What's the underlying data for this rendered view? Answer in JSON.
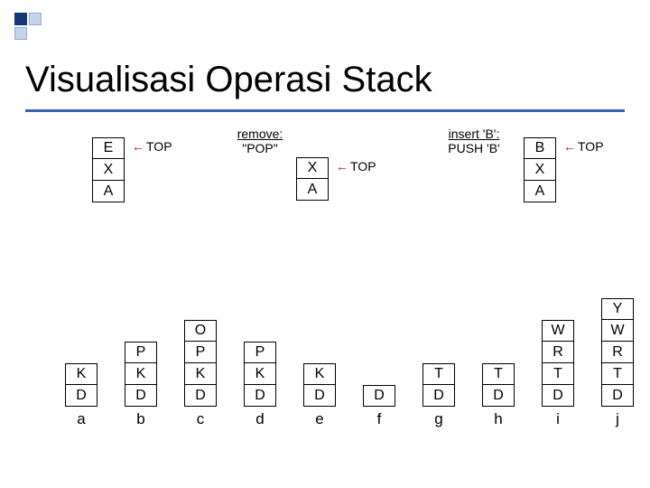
{
  "title": "Visualisasi Operasi Stack",
  "top_pointers": {
    "left": {
      "cells": [
        "E",
        "X",
        "A"
      ],
      "top_label": "TOP"
    },
    "mid": {
      "cells": [
        "X",
        "A"
      ],
      "top_label": "TOP",
      "op_u": "remove:",
      "op_l": "\"POP\""
    },
    "right": {
      "cells": [
        "B",
        "X",
        "A"
      ],
      "top_label": "TOP",
      "op_u": "insert 'B':",
      "op_l": "PUSH 'B'"
    }
  },
  "history": {
    "a": [
      "K",
      "D"
    ],
    "b": [
      "P",
      "K",
      "D"
    ],
    "c": [
      "O",
      "P",
      "K",
      "D"
    ],
    "d": [
      "P",
      "K",
      "D"
    ],
    "e": [
      "K",
      "D"
    ],
    "f": [
      "D"
    ],
    "g": [
      "T",
      "D"
    ],
    "h": [
      "T",
      "D"
    ],
    "i": [
      "R",
      "T",
      "D"
    ],
    "j": [
      "W",
      "R",
      "T",
      "D"
    ]
  },
  "history_extra": {
    "i": [
      "W"
    ],
    "j": [
      "Y"
    ]
  },
  "foot": {
    "a": "a",
    "b": "b",
    "c": "c",
    "d": "d",
    "e": "e",
    "f": "f",
    "g": "g",
    "h": "h",
    "i": "i",
    "j": "j"
  }
}
